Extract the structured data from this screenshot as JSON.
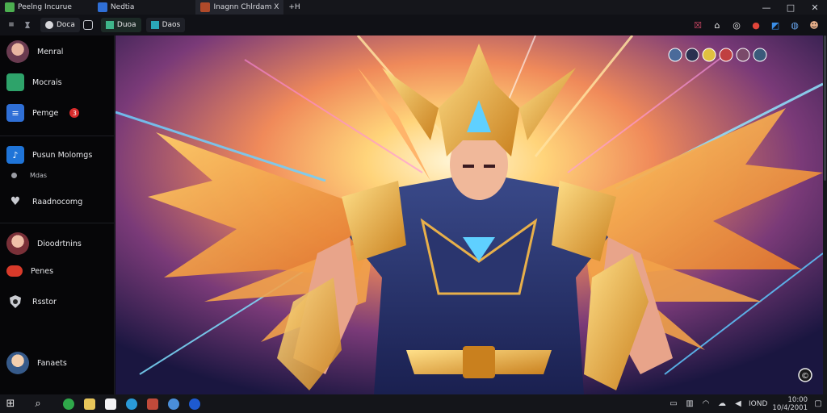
{
  "titlebar": {
    "tabs": [
      {
        "label": "Peelng Incurue",
        "color": "#4caf50"
      },
      {
        "label": "Nedtia",
        "color": "#2f6fd6"
      },
      {
        "label": "Inagnn Chlrdam X",
        "color": "#b04a2a"
      },
      {
        "label": "+H",
        "color": ""
      }
    ],
    "window_controls": [
      "—",
      "□",
      "✕"
    ]
  },
  "toolbar": {
    "menu_icon": "≡",
    "chips": [
      {
        "label": "Doca"
      },
      {
        "label": "Duoa"
      },
      {
        "label": "Daos"
      }
    ],
    "right_icons": [
      "☒",
      "⌂",
      "◎",
      "●",
      "◩",
      "◍",
      "☻"
    ]
  },
  "sidebar": {
    "items": [
      {
        "label": "Menral",
        "icon": "avatar"
      },
      {
        "label": "Mocrais",
        "icon": "folder-green-icon"
      },
      {
        "label": "Pemge",
        "icon": "doc-blue-icon",
        "badge": "3"
      },
      {
        "label": "Pusun Molomgs",
        "icon": "music-blue-icon"
      },
      {
        "label": "Mdas",
        "icon": "dot-icon"
      },
      {
        "label": "Raadnocomg",
        "icon": "heart-icon"
      },
      {
        "label": "Dioodrtnins",
        "icon": "avatar"
      },
      {
        "label": "Penes",
        "icon": "red-dot-icon"
      },
      {
        "label": "Rsstor",
        "icon": "shield-icon"
      },
      {
        "label": "Fanaets",
        "icon": "avatar"
      }
    ]
  },
  "main": {
    "top_right_avatars": 6,
    "corner_icon": "©"
  },
  "taskbar": {
    "start": "⊞",
    "search": "⌕",
    "tray_text": "IOND",
    "time": "10:00",
    "date": "10/4/2001"
  },
  "colors": {
    "accent": "#2f6fd6",
    "badge": "#d92b2b",
    "sidebar_bg": "#060608",
    "titlebar_bg": "#15161b"
  }
}
